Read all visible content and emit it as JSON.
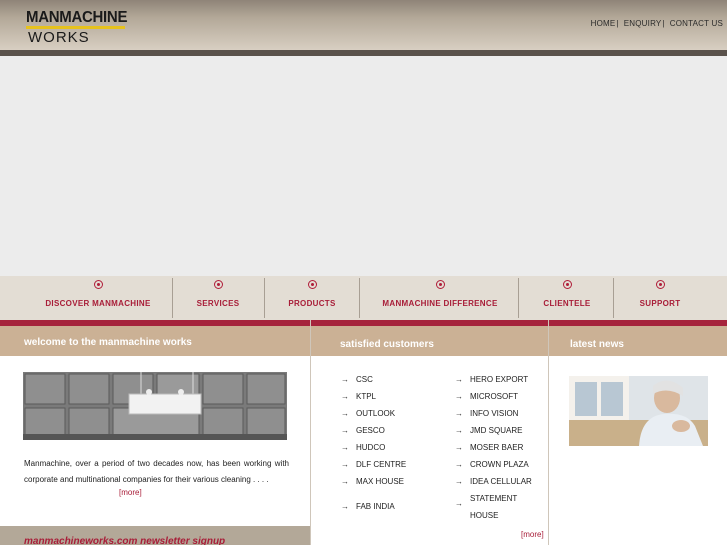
{
  "logo": {
    "line1": "MANMACHINE",
    "line2": "WORKS"
  },
  "toplinks": [
    {
      "label": "HOME",
      "sep": "|"
    },
    {
      "label": "ENQUIRY",
      "sep": "|"
    },
    {
      "label": "CONTACT US",
      "sep": ""
    }
  ],
  "nav": [
    {
      "label": "DISCOVER MANMACHINE"
    },
    {
      "label": "SERVICES"
    },
    {
      "label": "PRODUCTS"
    },
    {
      "label": "MANMACHINE DIFFERENCE"
    },
    {
      "label": "CLIENTELE"
    },
    {
      "label": "SUPPORT"
    }
  ],
  "welcome": {
    "title": "welcome to the manmachine works",
    "text": "Manmachine, over a period of two decades now, has been working with corporate and multinational companies for their various cleaning . . . .",
    "more": "[more]"
  },
  "newsletter": {
    "label": "manmachineworks.com newsletter signup"
  },
  "customers": {
    "title": "satisfied customers",
    "left": [
      "CSC",
      "KTPL",
      "OUTLOOK",
      "GESCO",
      "HUDCO",
      "DLF CENTRE",
      "MAX HOUSE",
      "FAB INDIA"
    ],
    "right": [
      "HERO EXPORT",
      "MICROSOFT",
      "INFO VISION",
      "JMD SQUARE",
      "MOSER BAER",
      "CROWN PLAZA",
      "IDEA CELLULAR",
      "STATEMENT HOUSE"
    ],
    "more": "[more]"
  },
  "news": {
    "title": "latest news"
  },
  "colors": {
    "accent": "#a81d38",
    "tan": "#cbb195",
    "navbg": "#e3ddd4"
  }
}
